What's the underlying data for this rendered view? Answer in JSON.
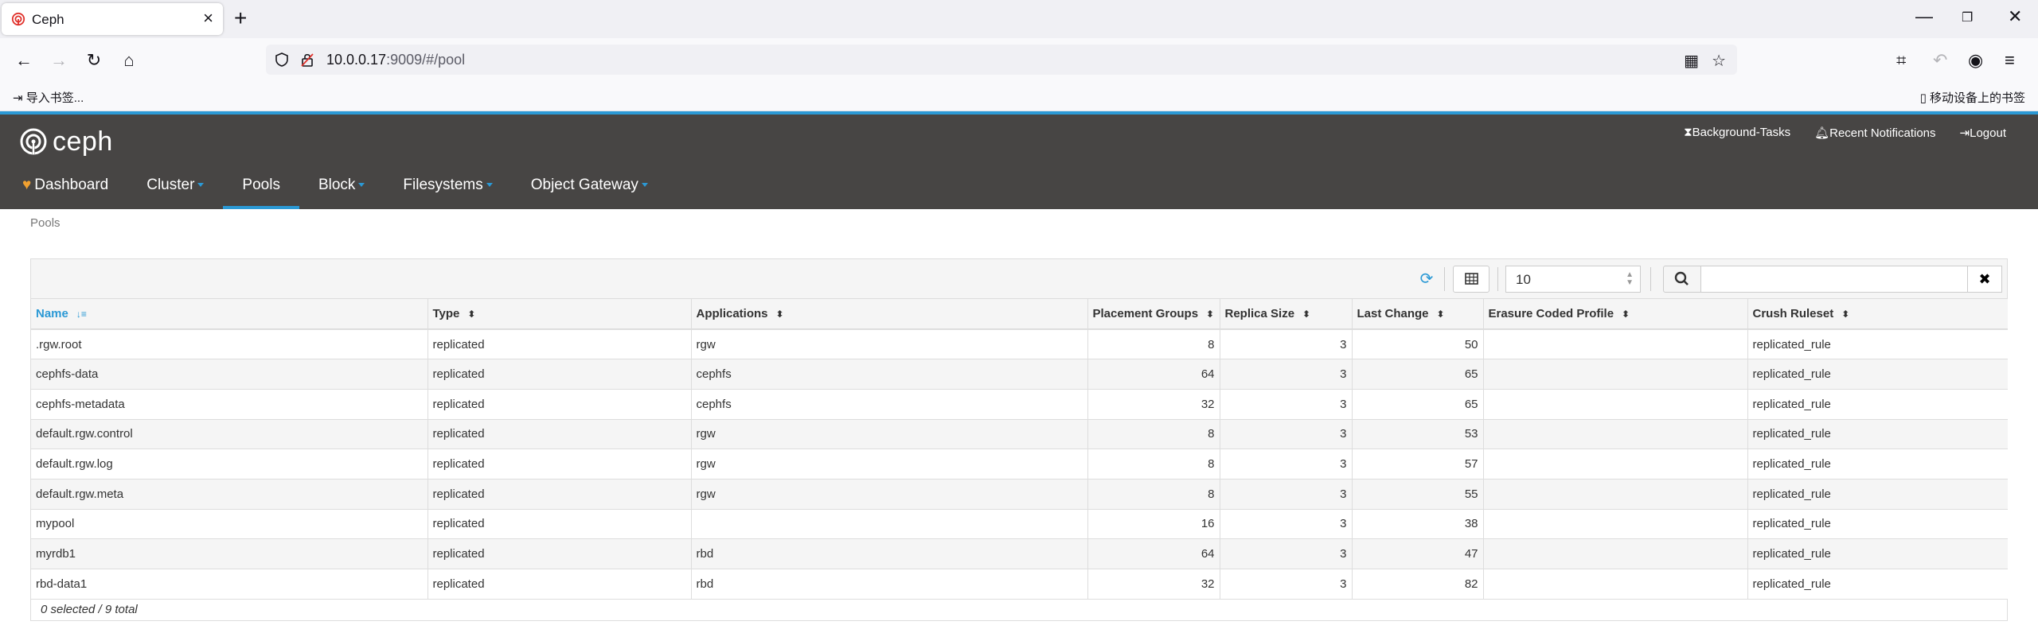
{
  "browser": {
    "tab_title": "Ceph",
    "url_host": "10.0.0.17",
    "url_rest": ":9009/#/pool",
    "bookmark_import": "导入书签...",
    "bookmark_mobile": "移动设备上的书签"
  },
  "header": {
    "logo_text": "ceph",
    "top_links": [
      "Background-Tasks",
      "Recent Notifications",
      "Logout"
    ],
    "nav": [
      {
        "label": "Dashboard",
        "dropdown": false
      },
      {
        "label": "Cluster",
        "dropdown": true
      },
      {
        "label": "Pools",
        "dropdown": false,
        "active": true
      },
      {
        "label": "Block",
        "dropdown": true
      },
      {
        "label": "Filesystems",
        "dropdown": true
      },
      {
        "label": "Object Gateway",
        "dropdown": true
      }
    ]
  },
  "breadcrumb": "Pools",
  "toolbar": {
    "page_size": "10",
    "search_value": ""
  },
  "table": {
    "columns": [
      "Name",
      "Type",
      "Applications",
      "Placement Groups",
      "Replica Size",
      "Last Change",
      "Erasure Coded Profile",
      "Crush Ruleset"
    ],
    "rows": [
      [
        ".rgw.root",
        "replicated",
        "rgw",
        "8",
        "3",
        "50",
        "",
        "replicated_rule"
      ],
      [
        "cephfs-data",
        "replicated",
        "cephfs",
        "64",
        "3",
        "65",
        "",
        "replicated_rule"
      ],
      [
        "cephfs-metadata",
        "replicated",
        "cephfs",
        "32",
        "3",
        "65",
        "",
        "replicated_rule"
      ],
      [
        "default.rgw.control",
        "replicated",
        "rgw",
        "8",
        "3",
        "53",
        "",
        "replicated_rule"
      ],
      [
        "default.rgw.log",
        "replicated",
        "rgw",
        "8",
        "3",
        "57",
        "",
        "replicated_rule"
      ],
      [
        "default.rgw.meta",
        "replicated",
        "rgw",
        "8",
        "3",
        "55",
        "",
        "replicated_rule"
      ],
      [
        "mypool",
        "replicated",
        "",
        "16",
        "3",
        "38",
        "",
        "replicated_rule"
      ],
      [
        "myrdb1",
        "replicated",
        "rbd",
        "64",
        "3",
        "47",
        "",
        "replicated_rule"
      ],
      [
        "rbd-data1",
        "replicated",
        "rbd",
        "32",
        "3",
        "82",
        "",
        "replicated_rule"
      ]
    ],
    "footer": "0 selected / 9 total"
  },
  "colors": {
    "accent": "#2b99d5",
    "header_bg": "#474544"
  }
}
